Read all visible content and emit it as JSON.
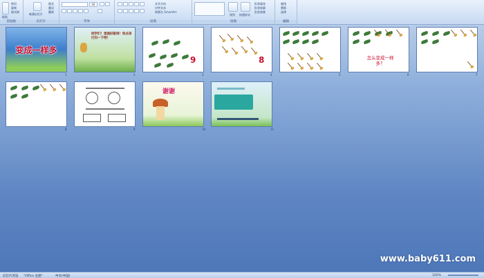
{
  "ribbon": {
    "groups": [
      {
        "id": "clipboard",
        "label": "剪贴板",
        "items": [
          "剪切",
          "复制",
          "格式刷"
        ],
        "paste_label": "粘贴"
      },
      {
        "id": "slides",
        "label": "幻灯片",
        "items": [
          "版式",
          "重设",
          "删除"
        ],
        "new_slide_label": "新建幻灯片"
      },
      {
        "id": "font",
        "label": "字体",
        "size_value": "18"
      },
      {
        "id": "paragraph",
        "label": "段落",
        "items": [
          "文字方向",
          "对齐文本",
          "转换为 SmartArt"
        ]
      },
      {
        "id": "drawing",
        "label": "绘图",
        "items": [
          "形状填充",
          "形状轮廓",
          "形状效果"
        ],
        "arrange_label": "排列",
        "quick_styles_label": "快速样式"
      },
      {
        "id": "editing",
        "label": "编辑",
        "items": [
          "查找",
          "替换",
          "选择"
        ]
      }
    ]
  },
  "slides": [
    {
      "num": "1",
      "title": "变成一样多"
    },
    {
      "num": "2",
      "text": "同学们！里面好脏呀！快点来打扫一下吧！"
    },
    {
      "num": "3",
      "digit": "9"
    },
    {
      "num": "4",
      "digit": "8"
    },
    {
      "num": "5"
    },
    {
      "num": "6",
      "text": "怎么变成一样多？"
    },
    {
      "num": "7"
    },
    {
      "num": "8"
    },
    {
      "num": "9"
    },
    {
      "num": "10",
      "title": "谢谢"
    },
    {
      "num": "11"
    }
  ],
  "status": {
    "slide_info": "幻灯片浏览",
    "theme": "\"Office 主题\"",
    "language": "中文(中国)",
    "zoom": "100%"
  },
  "watermark": "www.baby611.com",
  "colors": {
    "ribbon_bg": "#d4e3f6",
    "workspace_bg": "#5f86c3",
    "leaf_green": "#3d7a3a",
    "title_red": "#c8102e"
  }
}
